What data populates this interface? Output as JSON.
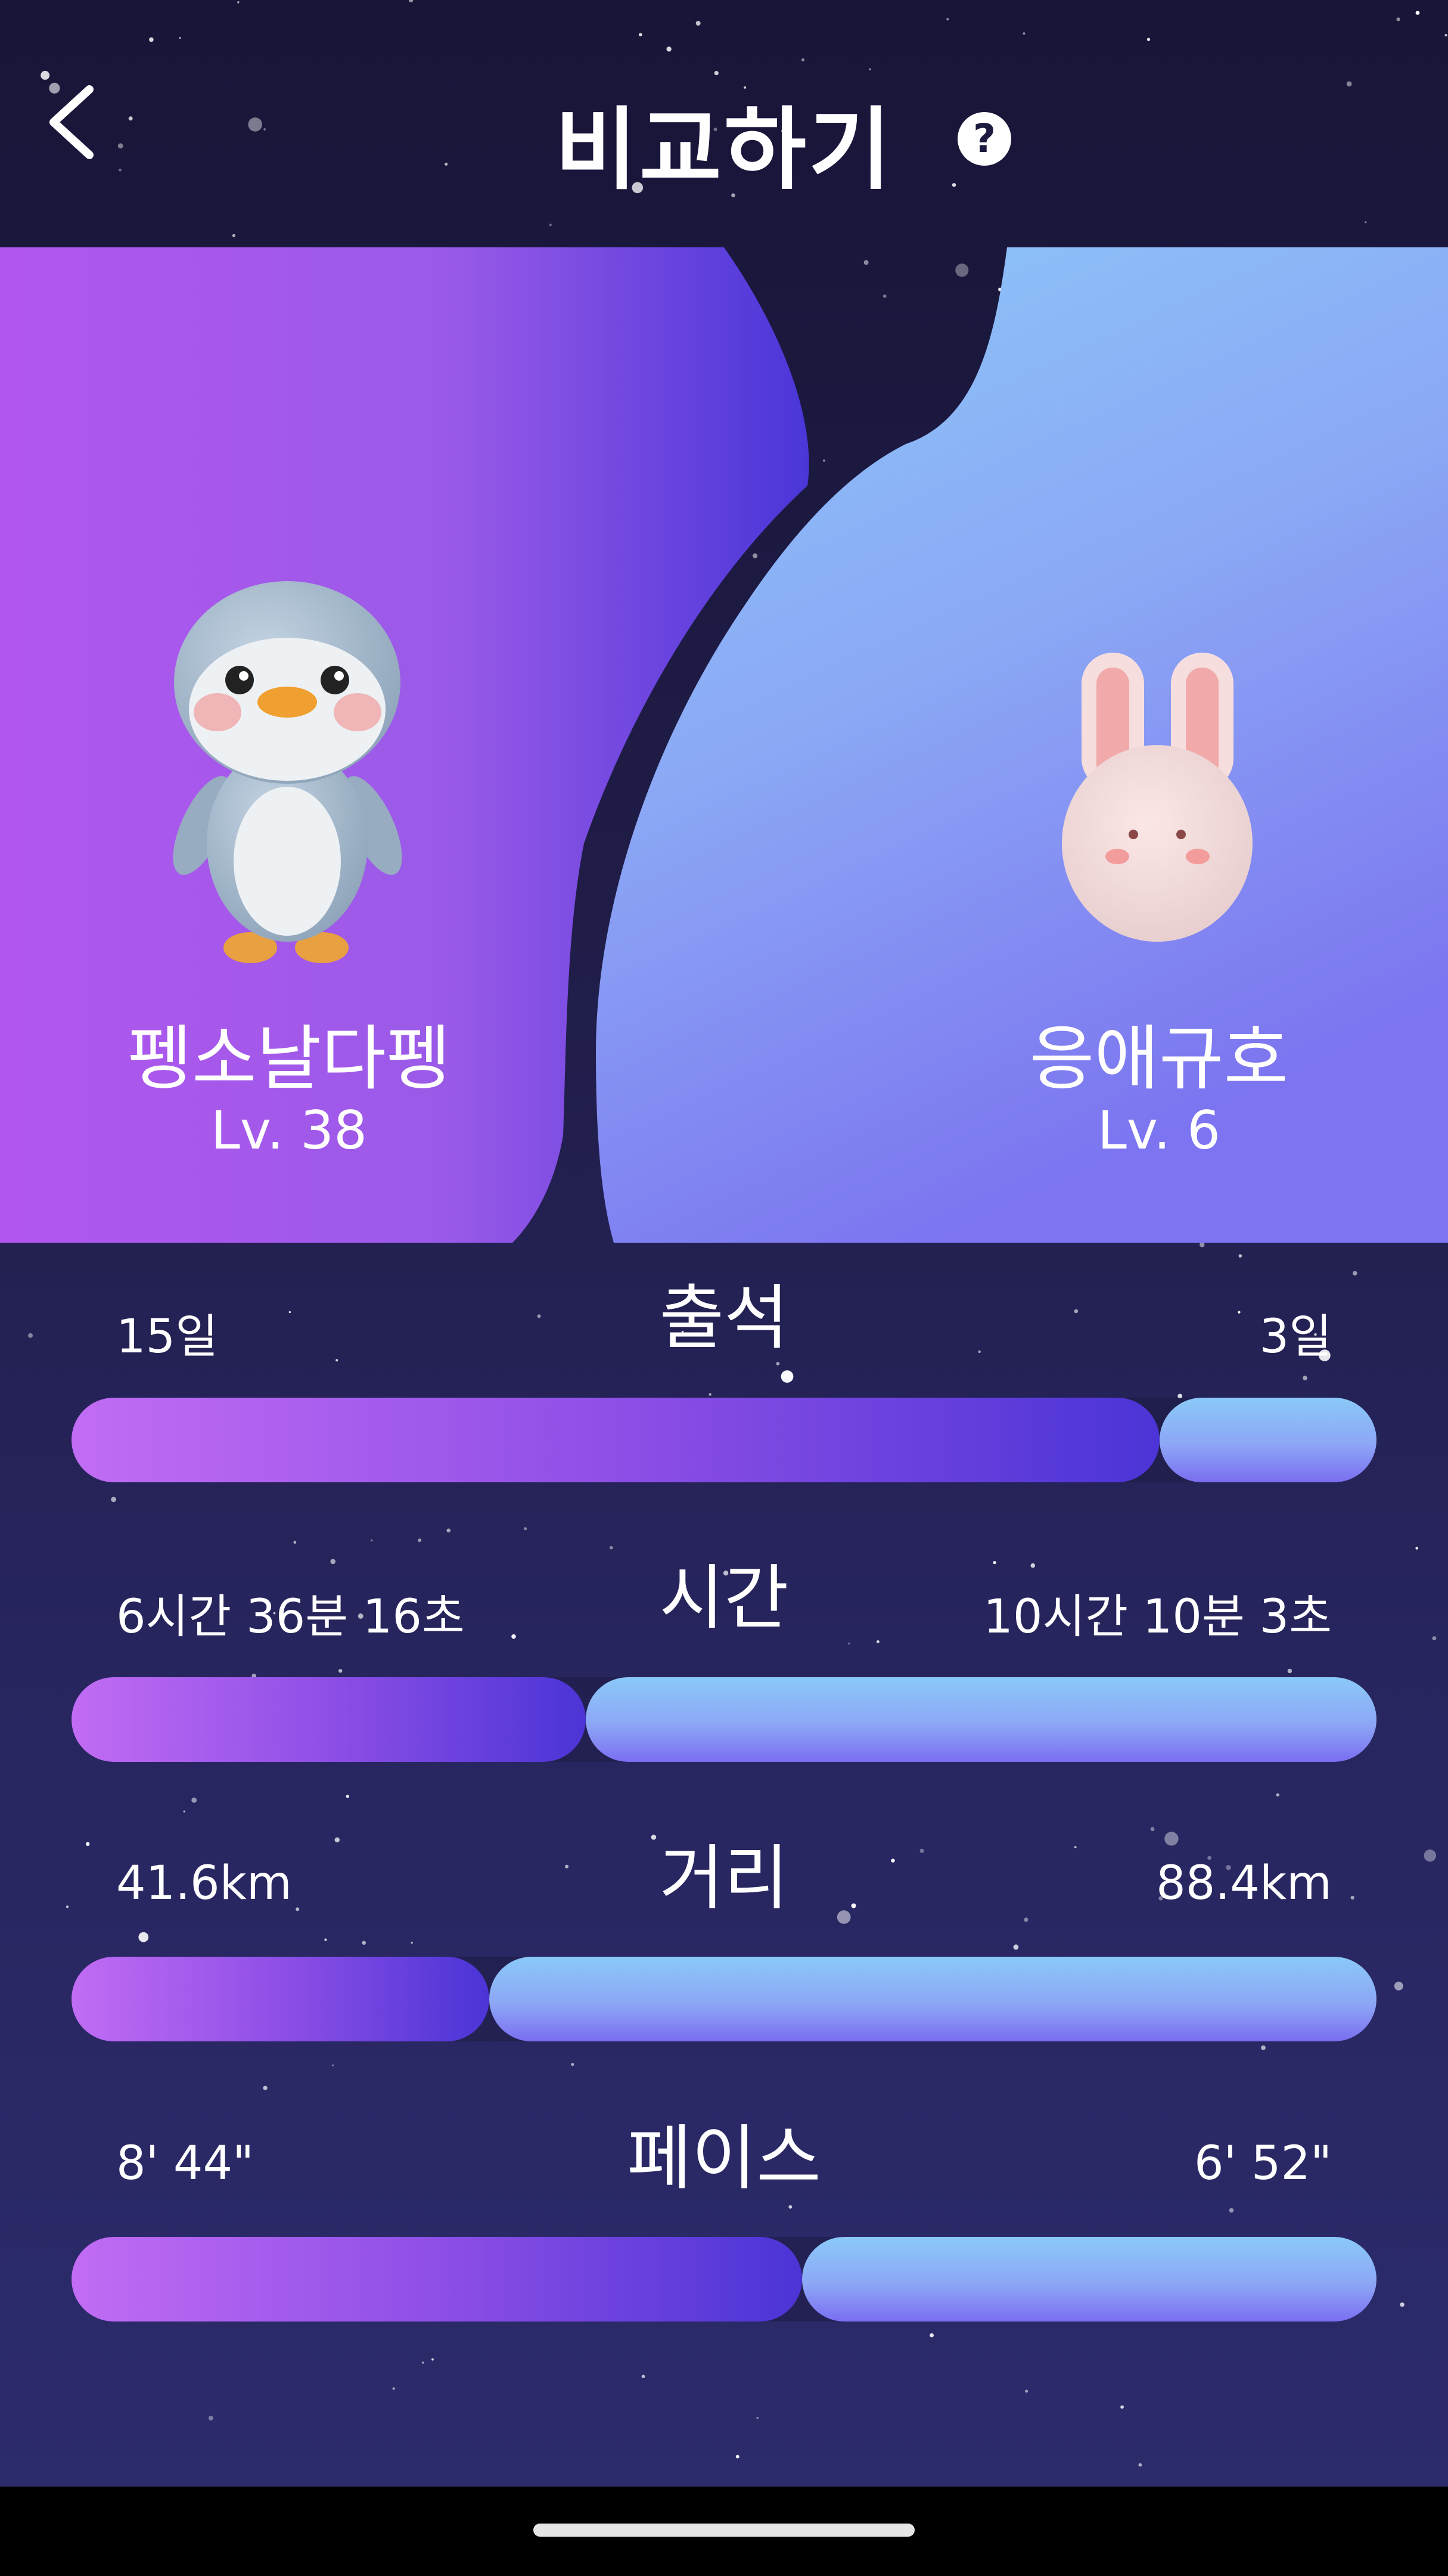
{
  "header": {
    "title": "비교하기",
    "help_label": "?"
  },
  "players": {
    "left": {
      "name": "펭소날다펭",
      "level": "Lv. 38",
      "avatar": "penguin-icon"
    },
    "right": {
      "name": "응애규호",
      "level": "Lv. 6",
      "avatar": "rabbit-icon"
    }
  },
  "stats": [
    {
      "label": "출석",
      "left_value": "15일",
      "right_value": "3일",
      "left_share": 0.834
    },
    {
      "label": "시간",
      "left_value": "6시간 36분 16초",
      "right_value": "10시간 10분 3초",
      "left_share": 0.394
    },
    {
      "label": "거리",
      "left_value": "41.6km",
      "right_value": "88.4km",
      "left_share": 0.32
    },
    {
      "label": "페이스",
      "left_value": "8' 44\"",
      "right_value": "6' 52\"",
      "left_share": 0.56
    }
  ],
  "colors": {
    "left_gradient": [
      "#c16cf4",
      "#4b34d6"
    ],
    "right_gradient": [
      "#8ac9f8",
      "#7a6ef0"
    ],
    "background": "#1f1c47"
  }
}
